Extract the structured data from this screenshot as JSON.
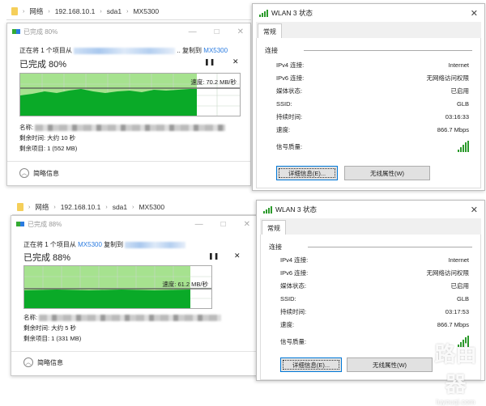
{
  "top": {
    "explorer": {
      "crumbs": [
        "网络",
        "192.168.10.1",
        "sda1",
        "MX5300"
      ]
    },
    "copy": {
      "title": "已完成 80%",
      "line_prefix": "正在将 1 个项目从",
      "line_mid": ".. 复制到",
      "line_dest": "MX5300",
      "progress_label": "已完成 80%",
      "progress": 0.8,
      "speed": "速度: 70.2 MB/秒",
      "name_label": "名称:",
      "time_left": "剩余时间: 大约 10 秒",
      "items_left": "剩余项目: 1 (552 MB)",
      "brief": "简略信息"
    },
    "wlan": {
      "title": "WLAN 3 状态",
      "tab": "常规",
      "group": "连接",
      "rows": [
        {
          "label": "IPv4 连接:",
          "value": "Internet"
        },
        {
          "label": "IPv6 连接:",
          "value": "无网络访问权限"
        },
        {
          "label": "媒体状态:",
          "value": "已启用"
        },
        {
          "label": "SSID:",
          "value": "GLB"
        },
        {
          "label": "持续时间:",
          "value": "03:16:33"
        },
        {
          "label": "速度:",
          "value": "866.7 Mbps"
        }
      ],
      "signal_label": "信号质量:",
      "details_btn": "详细信息(E)...",
      "wireless_btn": "无线属性(W)"
    }
  },
  "bottom": {
    "explorer": {
      "crumbs": [
        "网络",
        "192.168.10.1",
        "sda1",
        "MX5300"
      ]
    },
    "copy": {
      "title": "已完成 88%",
      "line_prefix": "正在将 1 个项目从",
      "line_src": "MX5300",
      "line_mid": "复制到",
      "progress_label": "已完成 88%",
      "progress": 0.88,
      "speed": "速度: 61.2 MB/秒",
      "name_label": "名称:",
      "time_left": "剩余时间: 大约 5 秒",
      "items_left": "剩余项目: 1 (331 MB)",
      "brief": "简略信息"
    },
    "wlan": {
      "title": "WLAN 3 状态",
      "tab": "常规",
      "group": "连接",
      "rows": [
        {
          "label": "IPv4 连接:",
          "value": "Internet"
        },
        {
          "label": "IPv6 连接:",
          "value": "无网络访问权限"
        },
        {
          "label": "媒体状态:",
          "value": "已启用"
        },
        {
          "label": "SSID:",
          "value": "GLB"
        },
        {
          "label": "持续时间:",
          "value": "03:17:53"
        },
        {
          "label": "速度:",
          "value": "866.7 Mbps"
        }
      ],
      "signal_label": "信号质量:",
      "details_btn": "详细信息(E)...",
      "wireless_btn": "无线属性(W)"
    }
  },
  "watermark": {
    "text": "路由器",
    "sub": "luyouqi.com"
  },
  "colors": {
    "graph_fill": "#0aaa28",
    "graph_bg": "#a6e28f",
    "link": "#2a7be0"
  }
}
